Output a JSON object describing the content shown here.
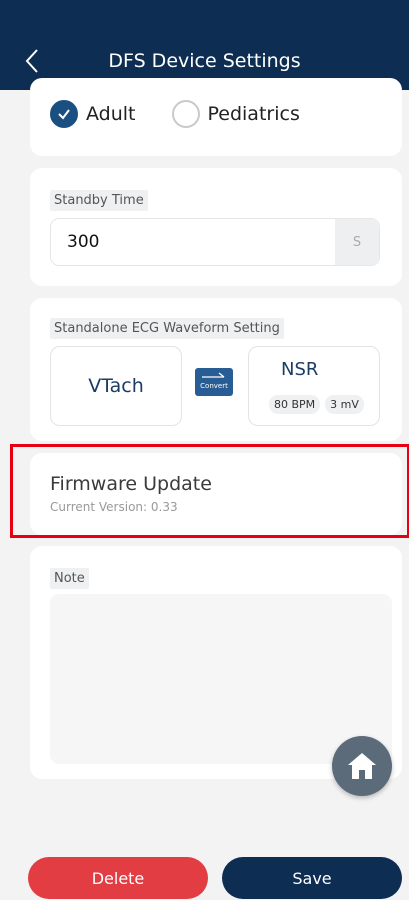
{
  "header": {
    "title": "DFS Device Settings"
  },
  "pad_type": {
    "options": [
      {
        "label": "Adult",
        "checked": true
      },
      {
        "label": "Pediatrics",
        "checked": false
      }
    ]
  },
  "standby": {
    "label": "Standby Time",
    "value": "300",
    "unit": "S"
  },
  "ecg": {
    "label": "Standalone ECG Waveform Setting",
    "left_waveform": "VTach",
    "convert_label": "Convert",
    "right_waveform": {
      "name": "NSR",
      "bpm": "80 BPM",
      "amplitude": "3 mV"
    }
  },
  "firmware": {
    "title": "Firmware Update",
    "version": "Current Version: 0.33"
  },
  "note": {
    "label": "Note",
    "value": ""
  },
  "actions": {
    "delete_label": "Delete",
    "save_label": "Save"
  },
  "colors": {
    "header": "#0d2d52",
    "delete": "#e23d43",
    "save": "#0d2d52",
    "highlight": "#e60012"
  },
  "icons": {
    "back": "chevron-left-icon",
    "convert": "convert-arrow-icon",
    "home": "home-icon",
    "check": "check-icon"
  }
}
